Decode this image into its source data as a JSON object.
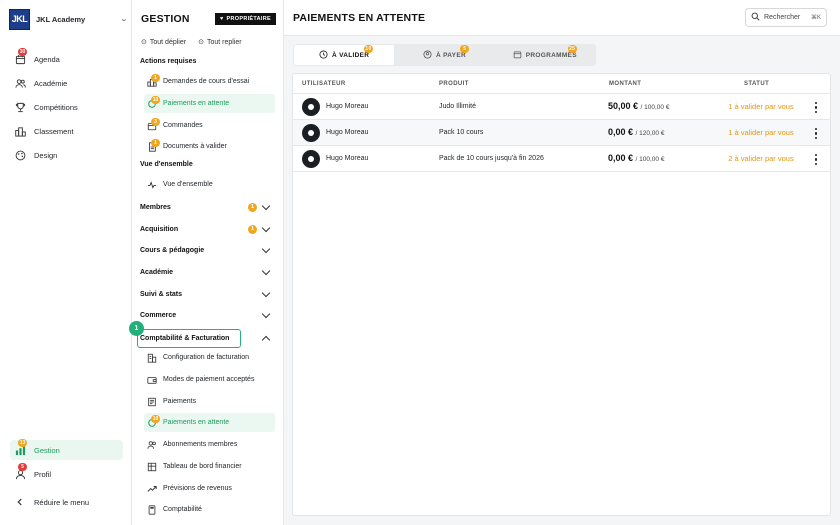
{
  "brand": {
    "logo_text": "JKL",
    "name": "JKL Academy"
  },
  "nav": {
    "items": [
      {
        "label": "Agenda",
        "icon": "calendar-icon",
        "badge": "30"
      },
      {
        "label": "Académie",
        "icon": "users-icon"
      },
      {
        "label": "Compétitions",
        "icon": "trophy-icon"
      },
      {
        "label": "Classement",
        "icon": "podium-icon"
      },
      {
        "label": "Design",
        "icon": "palette-icon"
      }
    ],
    "bottom": [
      {
        "label": "Gestion",
        "icon": "chart-icon",
        "badge": "13"
      },
      {
        "label": "Profil",
        "icon": "user-icon",
        "badge": "5"
      },
      {
        "label": "Réduire le menu",
        "icon": "chevron-left-icon"
      }
    ]
  },
  "panel": {
    "title": "GESTION",
    "owner_badge": "PROPRIÉTAIRE",
    "expand_all": "Tout déplier",
    "collapse_all": "Tout replier",
    "section_actions": "Actions requises",
    "actions": [
      {
        "label": "Demandes de cours d'essai",
        "badge": "1"
      },
      {
        "label": "Paiements en attente",
        "badge": "10"
      },
      {
        "label": "Commandes",
        "badge": "3"
      },
      {
        "label": "Documents à valider",
        "badge": "1"
      }
    ],
    "section_overview": "Vue d'ensemble",
    "overview_item": "Vue d'ensemble",
    "groups": [
      {
        "label": "Membres",
        "badge": "1"
      },
      {
        "label": "Acquisition",
        "badge": "1"
      },
      {
        "label": "Cours & pédagogie"
      },
      {
        "label": "Académie"
      },
      {
        "label": "Suivi & stats"
      },
      {
        "label": "Commerce"
      },
      {
        "label": "Comptabilité & Facturation"
      }
    ],
    "step_number": "1",
    "accounting_items": [
      {
        "label": "Configuration de facturation"
      },
      {
        "label": "Modes de paiement acceptés"
      },
      {
        "label": "Paiements"
      },
      {
        "label": "Paiements en attente",
        "badge": "10"
      },
      {
        "label": "Abonnements membres"
      },
      {
        "label": "Tableau de bord financier"
      },
      {
        "label": "Prévisions de revenus"
      },
      {
        "label": "Comptabilité"
      }
    ]
  },
  "main": {
    "title": "PAIEMENTS EN ATTENTE",
    "search_label": "Rechercher",
    "search_shortcut": "⌘K",
    "tabs": [
      {
        "label": "À VALIDER",
        "badge": "10"
      },
      {
        "label": "À PAYER",
        "badge": "5"
      },
      {
        "label": "PROGRAMMÉS",
        "badge": "25"
      }
    ],
    "columns": {
      "user": "UTILISATEUR",
      "product": "PRODUIT",
      "amount": "MONTANT",
      "status": "STATUT"
    },
    "rows": [
      {
        "user": "Hugo Moreau",
        "product": "Judo Illimité",
        "amount": "50,00 €",
        "total": "/ 100,00 €",
        "status": "1 à valider par vous"
      },
      {
        "user": "Hugo Moreau",
        "product": "Pack 10 cours",
        "amount": "0,00 €",
        "total": "/ 120,00 €",
        "status": "1 à valider par vous"
      },
      {
        "user": "Hugo Moreau",
        "product": "Pack de 10 cours jusqu'à fin 2026",
        "amount": "0,00 €",
        "total": "/ 100,00 €",
        "status": "2 à valider par vous"
      }
    ]
  },
  "colors": {
    "brand": "#1d3c8a",
    "accent": "#1e9a5f",
    "warning": "#f0a61f",
    "alert": "#e23c3c"
  }
}
